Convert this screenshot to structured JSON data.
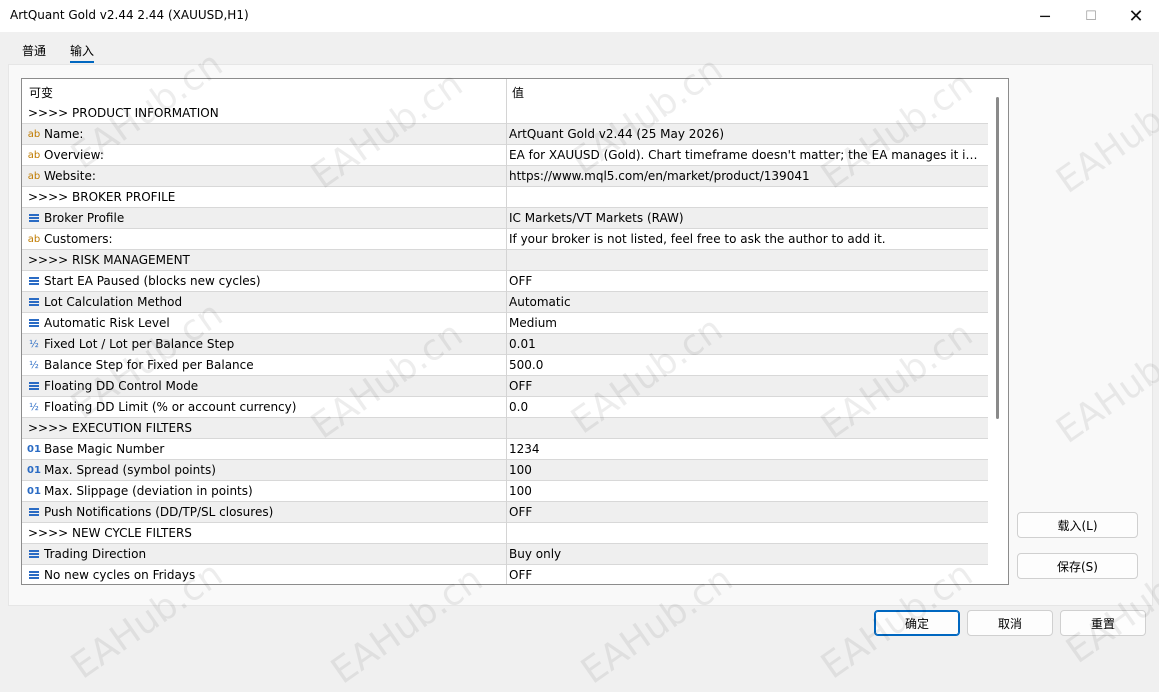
{
  "window": {
    "title": "ArtQuant Gold v2.44 2.44 (XAUUSD,H1)",
    "minimize_glyph": "─",
    "maximize_glyph": "☐",
    "close_glyph": "✕"
  },
  "tabs": [
    {
      "label": "普通"
    },
    {
      "label": "输入",
      "active": true
    }
  ],
  "grid": {
    "col_variable": "可变",
    "col_value": "值",
    "rows": [
      {
        "type": "group",
        "name": ">>>> PRODUCT INFORMATION",
        "value": ""
      },
      {
        "icon": "string-icon",
        "name": "Name:",
        "value": "ArtQuant Gold v2.44 (25 May 2026)"
      },
      {
        "icon": "string-icon",
        "name": "Overview:",
        "value": "EA for XAUUSD (Gold). Chart timeframe doesn't matter; the EA manages it inter..."
      },
      {
        "icon": "string-icon",
        "name": "Website:",
        "value": "https://www.mql5.com/en/market/product/139041"
      },
      {
        "type": "group",
        "name": ">>>> BROKER PROFILE",
        "value": ""
      },
      {
        "icon": "enum-icon",
        "name": "Broker Profile",
        "value": "IC Markets/VT Markets (RAW)"
      },
      {
        "icon": "string-icon",
        "name": "Customers:",
        "value": "If your broker is not listed, feel free to ask the author to add it."
      },
      {
        "type": "group",
        "name": ">>>> RISK MANAGEMENT",
        "value": ""
      },
      {
        "icon": "enum-icon",
        "name": "Start EA Paused (blocks new cycles)",
        "value": "OFF"
      },
      {
        "icon": "enum-icon",
        "name": "Lot Calculation Method",
        "value": "Automatic"
      },
      {
        "icon": "enum-icon",
        "name": "Automatic Risk Level",
        "value": "Medium"
      },
      {
        "icon": "double-icon",
        "name": "Fixed Lot / Lot per Balance Step",
        "value": "0.01"
      },
      {
        "icon": "double-icon",
        "name": "Balance Step for Fixed per Balance",
        "value": "500.0"
      },
      {
        "icon": "enum-icon",
        "name": "Floating DD Control Mode",
        "value": "OFF"
      },
      {
        "icon": "double-icon",
        "name": "Floating DD Limit (% or account currency)",
        "value": "0.0"
      },
      {
        "type": "group",
        "name": ">>>> EXECUTION FILTERS",
        "value": ""
      },
      {
        "icon": "integer-icon",
        "name": "Base Magic Number",
        "value": "1234"
      },
      {
        "icon": "integer-icon",
        "name": "Max. Spread (symbol points)",
        "value": "100"
      },
      {
        "icon": "integer-icon",
        "name": "Max. Slippage (deviation in points)",
        "value": "100"
      },
      {
        "icon": "enum-icon",
        "name": "Push Notifications (DD/TP/SL closures)",
        "value": "OFF"
      },
      {
        "type": "group",
        "name": ">>>> NEW CYCLE FILTERS",
        "value": ""
      },
      {
        "icon": "enum-icon",
        "name": "Trading Direction",
        "value": "Buy only"
      },
      {
        "icon": "enum-icon",
        "name": "No new cycles on Fridays",
        "value": "OFF"
      }
    ]
  },
  "icons": {
    "string-icon": "ab",
    "integer-icon": "01",
    "double-icon": "½"
  },
  "side_buttons": {
    "load": "载入(L)",
    "save": "保存(S)"
  },
  "bottom_buttons": {
    "ok": "确定",
    "cancel": "取消",
    "reset": "重置"
  },
  "watermark": "EAHub.cn",
  "watermark_alt": "EAHub",
  "colors": {
    "accent": "#0067c0",
    "string_icon": "#c07b00",
    "enum_icon": "#2a6bc4"
  }
}
